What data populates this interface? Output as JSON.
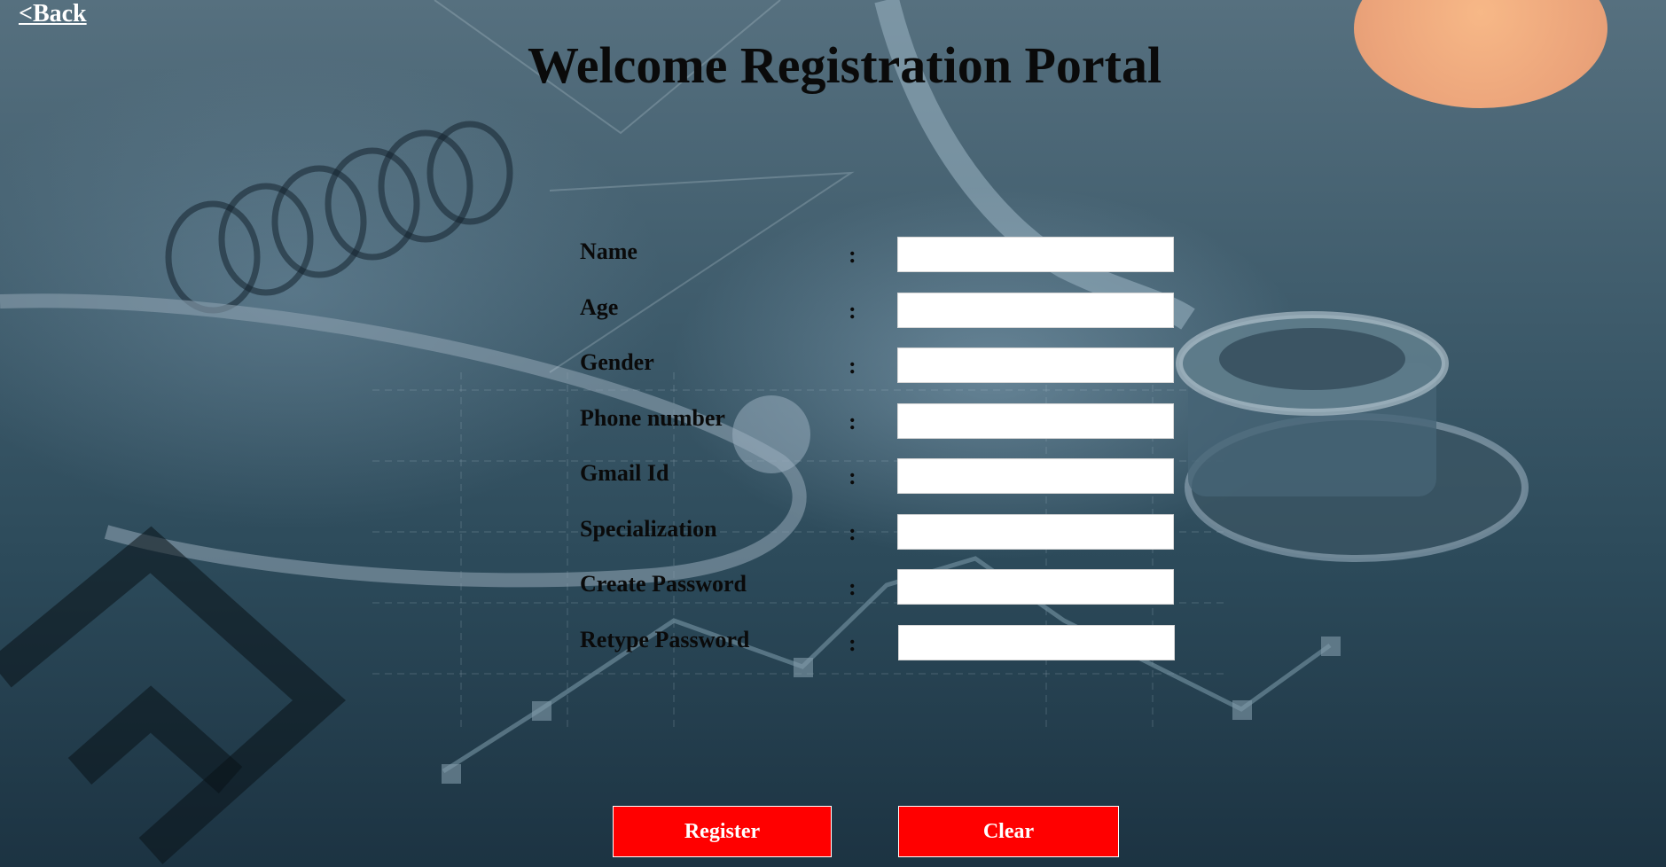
{
  "nav": {
    "back_label": "<Back"
  },
  "header": {
    "title": "Welcome Registration Portal"
  },
  "form": {
    "separator": ":",
    "fields": [
      {
        "label": "Name",
        "value": ""
      },
      {
        "label": "Age",
        "value": ""
      },
      {
        "label": "Gender",
        "value": ""
      },
      {
        "label": "Phone number",
        "value": ""
      },
      {
        "label": "Gmail Id",
        "value": ""
      },
      {
        "label": "Specialization",
        "value": ""
      },
      {
        "label": "Create Password",
        "value": ""
      },
      {
        "label": "Retype Password",
        "value": ""
      }
    ]
  },
  "actions": {
    "register_label": "Register",
    "clear_label": "Clear"
  },
  "colors": {
    "button_red": "#ff0000",
    "title_text": "#0a0a0a",
    "back_link": "#ffffff",
    "accent_sun": "#eba37a"
  }
}
